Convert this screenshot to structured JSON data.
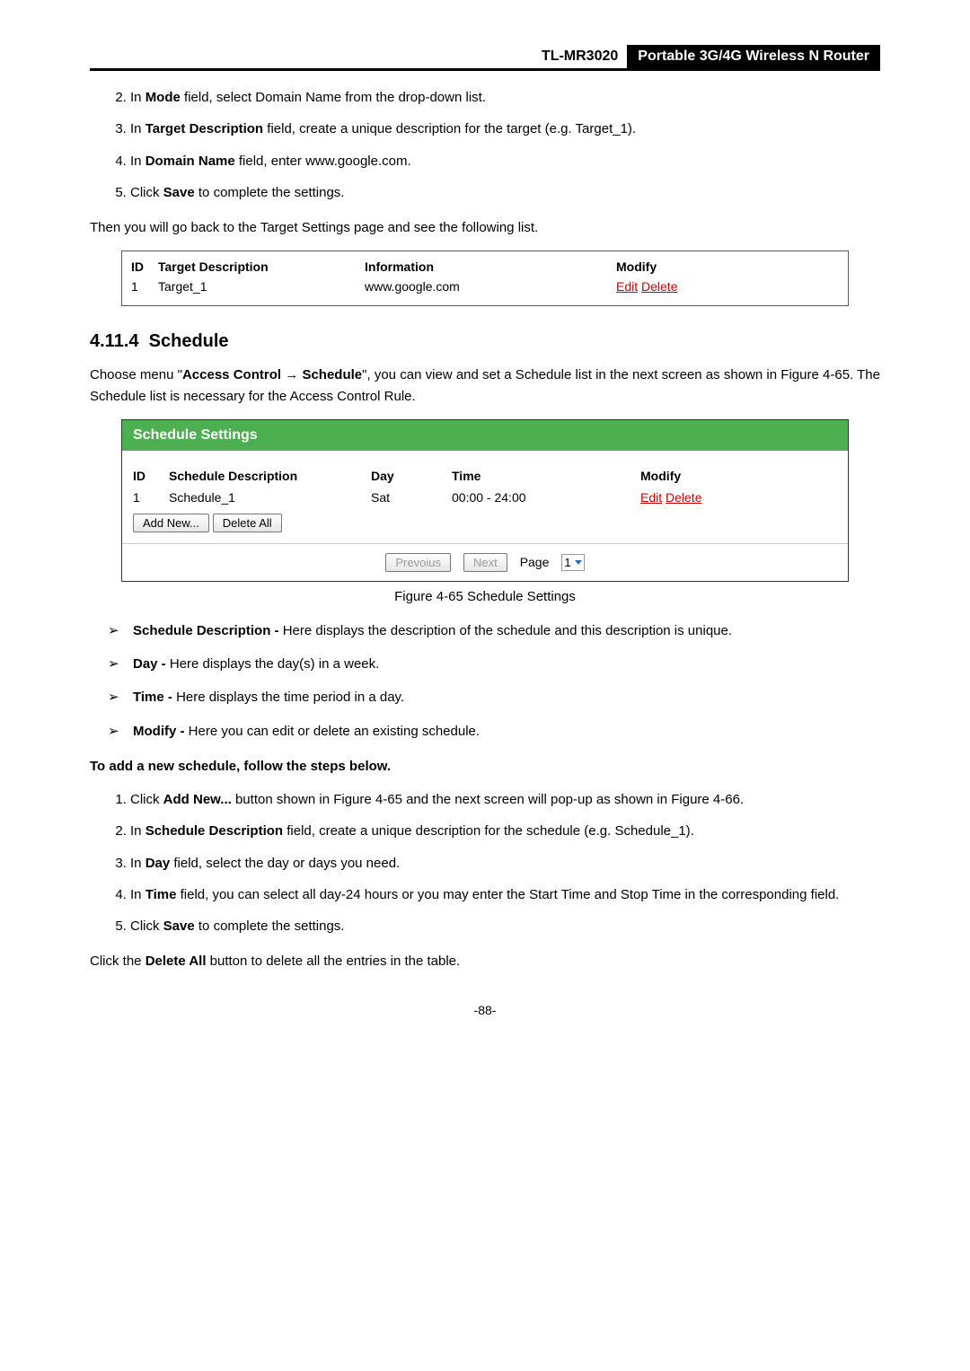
{
  "header": {
    "model": "TL-MR3020",
    "title": "Portable 3G/4G Wireless N Router"
  },
  "steps_top": [
    "In <b>Mode</b> field, select Domain Name from the drop-down list.",
    "In <b>Target Description</b> field, create a unique description for the target (e.g. Target_1).",
    "In <b>Domain Name</b> field, enter www.google.com.",
    "Click <b>Save</b> to complete the settings."
  ],
  "then_line": "Then you will go back to the Target Settings page and see the following list.",
  "target_table": {
    "header": {
      "id": "ID",
      "desc": "Target Description",
      "info": "Information",
      "mod": "Modify"
    },
    "row": {
      "id": "1",
      "desc": "Target_1",
      "info": "www.google.com",
      "edit": "Edit",
      "delete": "Delete"
    }
  },
  "section": {
    "number": "4.11.4",
    "title": "Schedule"
  },
  "intro": "Choose menu \"<b>Access Control</b> → <b>Schedule</b>\", you can view and set a Schedule list in the next screen as shown in Figure 4-65. The Schedule list is necessary for the Access Control Rule.",
  "schedule_box": {
    "title": "Schedule Settings",
    "header": {
      "id": "ID",
      "desc": "Schedule Description",
      "day": "Day",
      "time": "Time",
      "mod": "Modify"
    },
    "row": {
      "id": "1",
      "desc": "Schedule_1",
      "day": "Sat",
      "time": "00:00 - 24:00",
      "edit": "Edit",
      "delete": "Delete"
    },
    "buttons": {
      "add": "Add New...",
      "delete_all": "Delete All",
      "prev": "Prevoius",
      "next": "Next",
      "page_label": "Page",
      "page_value": "1"
    }
  },
  "figure_caption": "Figure 4-65   Schedule Settings",
  "bullets": [
    "<b>Schedule Description -</b> Here displays the description of the schedule and this description is unique.",
    "<b>Day -</b> Here displays the day(s) in a week.",
    "<b>Time -</b> Here displays the time period in a day.",
    "<b>Modify -</b> Here you can edit or delete an existing schedule."
  ],
  "steps_heading": "To add a new schedule, follow the steps below.",
  "steps_bottom": [
    "Click <b>Add New...</b> button shown in Figure 4-65 and the next screen will pop-up as shown in Figure 4-66.",
    "In <b>Schedule Description</b> field, create a unique description for the schedule (e.g. Schedule_1).",
    "In <b>Day</b> field, select the day or days you need.",
    "In <b>Time</b> field, you can select all day-24 hours or you may enter the Start Time and Stop Time in the corresponding field.",
    "Click <b>Save</b> to complete the settings."
  ],
  "delete_line": "Click the <b>Delete All</b> button to delete all the entries in the table.",
  "page_number": "-88-"
}
